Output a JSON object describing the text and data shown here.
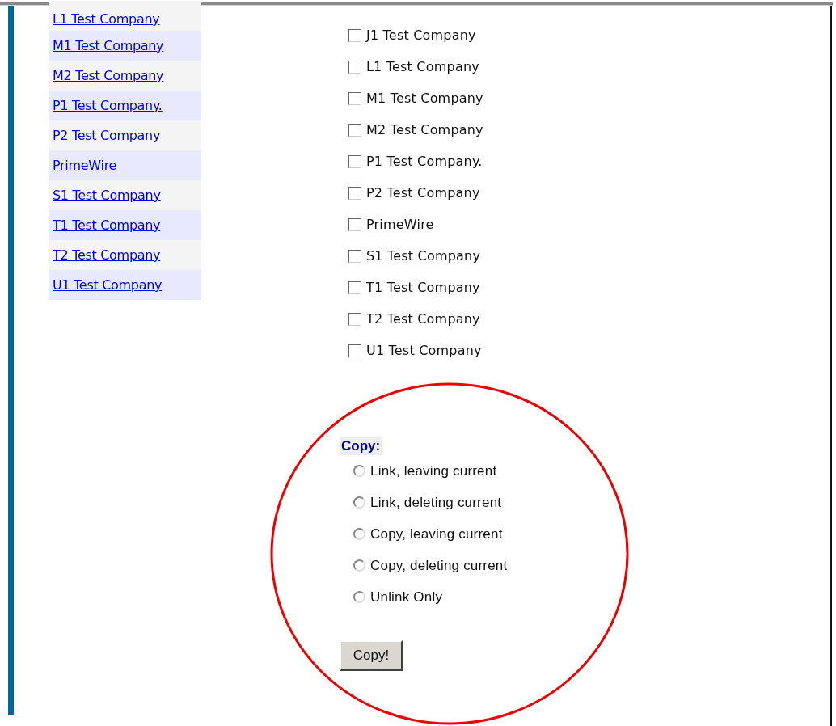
{
  "company_links": [
    {
      "label": "L1 Test Company"
    },
    {
      "label": "M1 Test Company"
    },
    {
      "label": "M2 Test Company"
    },
    {
      "label": "P1 Test Company."
    },
    {
      "label": "P2 Test Company"
    },
    {
      "label": "PrimeWire"
    },
    {
      "label": "S1 Test Company"
    },
    {
      "label": "T1 Test Company"
    },
    {
      "label": "T2 Test Company"
    },
    {
      "label": "U1 Test Company"
    }
  ],
  "company_checkboxes": [
    {
      "label": "J1 Test Company",
      "checked": false
    },
    {
      "label": "L1 Test Company",
      "checked": false
    },
    {
      "label": "M1 Test Company",
      "checked": false
    },
    {
      "label": "M2 Test Company",
      "checked": false
    },
    {
      "label": "P1 Test Company.",
      "checked": false
    },
    {
      "label": "P2 Test Company",
      "checked": false
    },
    {
      "label": "PrimeWire",
      "checked": false
    },
    {
      "label": "S1 Test Company",
      "checked": false
    },
    {
      "label": "T1 Test Company",
      "checked": false
    },
    {
      "label": "T2 Test Company",
      "checked": false
    },
    {
      "label": "U1 Test Company",
      "checked": false
    }
  ],
  "copy_section": {
    "heading": "Copy:",
    "options": [
      {
        "label": "Link, leaving current",
        "selected": false
      },
      {
        "label": "Link, deleting current",
        "selected": false
      },
      {
        "label": "Copy, leaving current",
        "selected": false
      },
      {
        "label": "Copy, deleting current",
        "selected": false
      },
      {
        "label": "Unlink Only",
        "selected": false
      }
    ],
    "button": "Copy!"
  },
  "annotation": {
    "kind": "circle"
  }
}
